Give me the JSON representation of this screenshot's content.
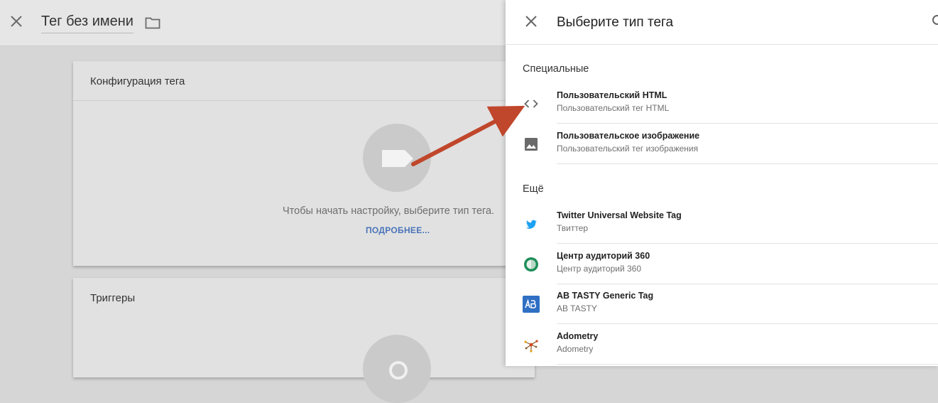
{
  "editor": {
    "title": "Тег без имени",
    "config_card": {
      "title": "Конфигурация тега",
      "hint": "Чтобы начать настройку, выберите тип тега.",
      "more_link": "ПОДРОБНЕЕ..."
    },
    "triggers_card": {
      "title": "Триггеры"
    }
  },
  "panel": {
    "title": "Выберите тип тега",
    "sections": [
      {
        "label": "Специальные",
        "items": [
          {
            "name": "Пользовательский HTML",
            "sub": "Пользовательский тег HTML",
            "icon": "code-icon"
          },
          {
            "name": "Пользовательское изображение",
            "sub": "Пользовательский тег изображения",
            "icon": "image-icon"
          }
        ]
      },
      {
        "label": "Ещё",
        "items": [
          {
            "name": "Twitter Universal Website Tag",
            "sub": "Твиттер",
            "icon": "twitter-icon"
          },
          {
            "name": "Центр аудиторий 360",
            "sub": "Центр аудиторий 360",
            "icon": "audience-center-icon"
          },
          {
            "name": "AB TASTY Generic Tag",
            "sub": "AB TASTY",
            "icon": "ab-tasty-icon"
          },
          {
            "name": "Adometry",
            "sub": "Adometry",
            "icon": "adometry-icon"
          }
        ]
      }
    ]
  },
  "colors": {
    "link": "#4a74b9",
    "annotation_arrow": "#c0472c",
    "twitter": "#1da1f2",
    "audience_green": "#1e8e5a",
    "ab_tasty_blue": "#2f6fc4"
  }
}
